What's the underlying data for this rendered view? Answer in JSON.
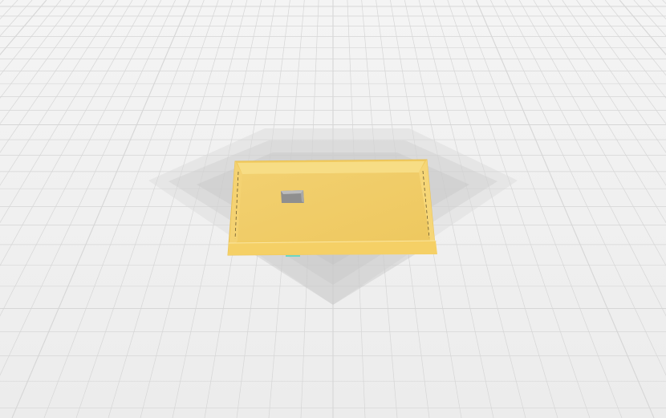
{
  "viewport": {
    "background_color": "#f0f0f0",
    "grid_color": "#d6d6d6",
    "grid_shadow_color": "#bdbdbd"
  },
  "model": {
    "name": "yellow-rectangular-tray",
    "color": "#f0cc6a",
    "hole": true
  },
  "icons": {
    "hole": "rectangular-hole-icon"
  }
}
